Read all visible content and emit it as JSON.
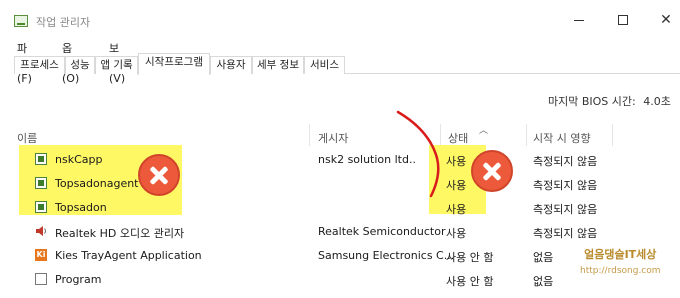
{
  "window": {
    "title": "작업 관리자",
    "controls": [
      "minimize",
      "maximize",
      "close"
    ]
  },
  "menu": [
    {
      "label": "파일(F)"
    },
    {
      "label": "옵션(O)"
    },
    {
      "label": "보기(V)"
    }
  ],
  "tabs": [
    {
      "label": "프로세스"
    },
    {
      "label": "성능"
    },
    {
      "label": "앱 기록"
    },
    {
      "label": "시작프로그램"
    },
    {
      "label": "사용자"
    },
    {
      "label": "세부 정보"
    },
    {
      "label": "서비스"
    }
  ],
  "active_tab": "시작프로그램",
  "bios": {
    "label": "마지막 BIOS 시간:",
    "value": "4.0초"
  },
  "columns": {
    "name": "이름",
    "publisher": "게시자",
    "status": "상태",
    "impact": "시작 시 영향"
  },
  "rows": [
    {
      "name": "nskCapp",
      "publisher": "nsk2 solution ltd..",
      "status": "사용",
      "impact": "측정되지 않음",
      "icon": "exe-icon"
    },
    {
      "name": "Topsadonagent",
      "publisher": "",
      "status": "사용",
      "impact": "측정되지 않음",
      "icon": "exe-icon"
    },
    {
      "name": "Topsadon",
      "publisher": "",
      "status": "사용",
      "impact": "측정되지 않음",
      "icon": "exe-icon"
    },
    {
      "name": "Realtek HD 오디오 관리자",
      "publisher": "Realtek Semiconductor",
      "status": "사용",
      "impact": "측정되지 않음",
      "icon": "speaker-icon"
    },
    {
      "name": "Kies TrayAgent Application",
      "publisher": "Samsung Electronics C...",
      "status": "사용 안 함",
      "impact": "없음",
      "icon": "kies-icon"
    },
    {
      "name": "Program",
      "publisher": "",
      "status": "사용 안 함",
      "impact": "없음",
      "icon": "document-icon"
    }
  ],
  "kies_icon_glyph": "Ki",
  "watermark": {
    "line1": "얼음댕슬IT세상",
    "line2": "http://rdsong.com"
  },
  "colors": {
    "highlight": "#fff74a",
    "x_mark": "#ed5a3b",
    "pen": "#d81b1b",
    "kies_orange": "#e7761c"
  }
}
